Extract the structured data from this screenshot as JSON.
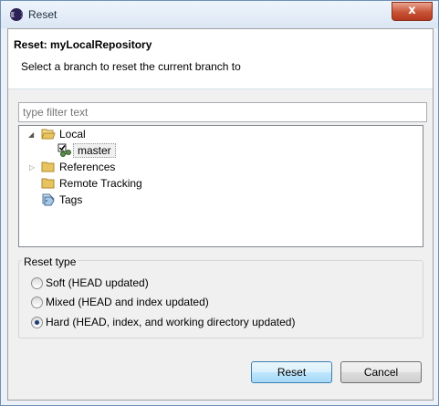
{
  "window": {
    "title": "Reset",
    "close_glyph": "x"
  },
  "header": {
    "title": "Reset: myLocalRepository",
    "description": "Select a branch to reset the current branch to"
  },
  "filter": {
    "placeholder": "type filter text"
  },
  "tree": {
    "local": "Local",
    "master": "master",
    "references": "References",
    "remote_tracking": "Remote Tracking",
    "tags": "Tags"
  },
  "reset_type": {
    "label": "Reset type",
    "options": [
      {
        "label": "Soft (HEAD updated)",
        "checked": false
      },
      {
        "label": "Mixed (HEAD and index updated)",
        "checked": false
      },
      {
        "label": "Hard (HEAD, index, and working directory updated)",
        "checked": true
      }
    ]
  },
  "buttons": {
    "reset": "Reset",
    "cancel": "Cancel"
  },
  "colors": {
    "folder": "#e8c460",
    "accent": "#3c7fb1",
    "selected_radio": "#1c3d73"
  }
}
